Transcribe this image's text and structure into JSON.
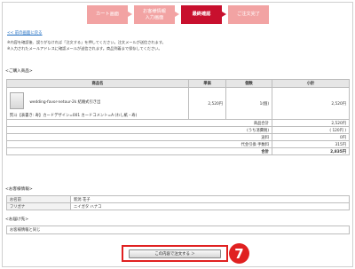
{
  "steps": [
    {
      "label": "カート画面"
    },
    {
      "label": "お客様情報\n入力画面"
    },
    {
      "label": "最終確認"
    },
    {
      "label": "ご注文完了"
    }
  ],
  "back_link": "<< 前の画面に戻る",
  "notes": [
    "※内容を確認後、誤りがなければ「注文する」を押してください。注文メールが送信されます。",
    "※入力されたメールアドレスに確認メールが送信されます。商品到着まで保存してください。"
  ],
  "purchase_section_title": "<ご購入商品>",
  "table_headers": {
    "product": "商品名",
    "unit_price": "単価",
    "quantity": "個数",
    "subtotal": "小計"
  },
  "product": {
    "name": "wedding-favor-netour-2k 結婚式引き出",
    "options": "熨斗【表書き: 寿】カードデザイン=001 カードコメント=A (わし紙・寿)",
    "unit_price": "2,520円",
    "quantity": "1(個)",
    "subtotal": "2,520円"
  },
  "summary": [
    {
      "label": "商品合計",
      "value": "2,520円"
    },
    {
      "label": "(うち消費税)",
      "value": "( 120円 )"
    },
    {
      "label": "送料",
      "value": "0円"
    },
    {
      "label": "代金引換 手数料",
      "value": "315円"
    },
    {
      "label": "合計",
      "value": "2,835円"
    }
  ],
  "customer_section_title": "<お客様情報>",
  "customer_rows": [
    {
      "label": "お名前",
      "value": "新潟 花子"
    },
    {
      "label": "フリガナ",
      "value": "ニイガタ ハナコ"
    }
  ],
  "destination_section_title": "<お届け先>",
  "destination_value": "お客様情報と同じ",
  "submit_label": "この内容で注文する ＞",
  "callout_number": "7",
  "colors": {
    "accent": "#c8102e",
    "step_inactive": "#f2a3a3",
    "callout": "#e02020"
  }
}
